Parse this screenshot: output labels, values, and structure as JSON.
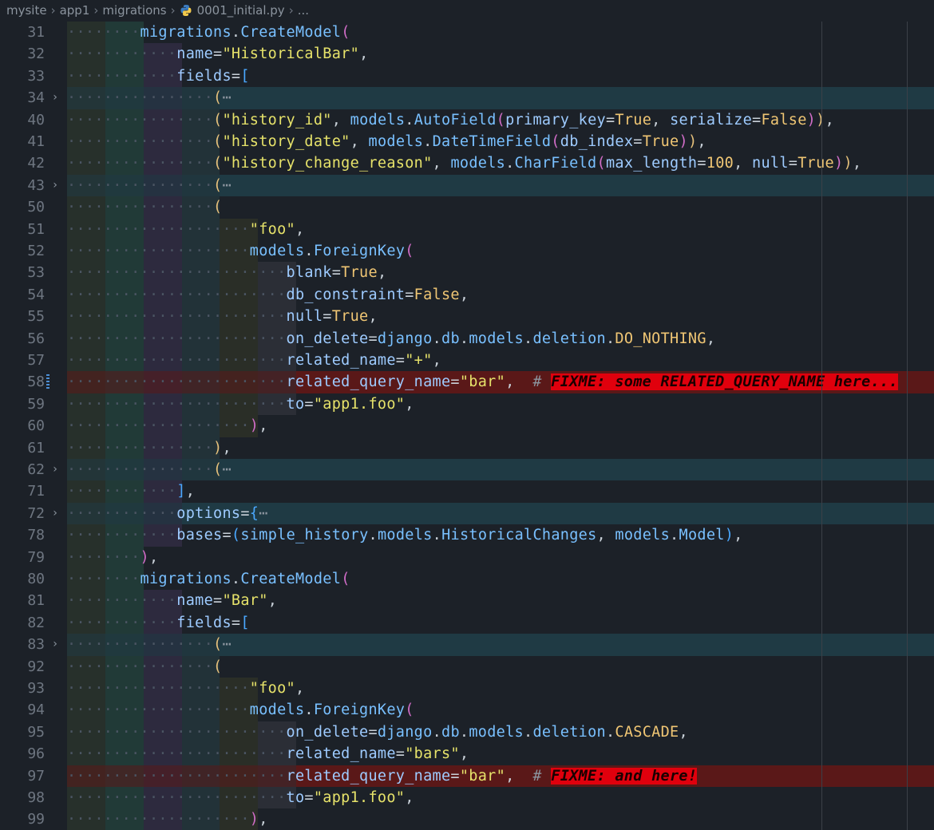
{
  "breadcrumb": {
    "items": [
      "mysite",
      "app1",
      "migrations",
      "0001_initial.py",
      "..."
    ]
  },
  "editor": {
    "lines": [
      {
        "n": "31",
        "indent": 2,
        "tokens": [
          [
            "f",
            "migrations"
          ],
          [
            "p",
            "."
          ],
          [
            "f",
            "CreateModel"
          ],
          [
            "b2",
            "("
          ]
        ]
      },
      {
        "n": "32",
        "indent": 3,
        "tokens": [
          [
            "k",
            "name"
          ],
          [
            "p",
            "="
          ],
          [
            "s",
            "\"HistoricalBar\""
          ],
          [
            "p",
            ","
          ]
        ]
      },
      {
        "n": "33",
        "indent": 3,
        "tokens": [
          [
            "k",
            "fields"
          ],
          [
            "p",
            "="
          ],
          [
            "b3",
            "["
          ]
        ]
      },
      {
        "n": "34",
        "indent": 4,
        "fold": true,
        "tokens": [
          [
            "b1",
            "("
          ],
          [
            "ell",
            "⋯"
          ]
        ]
      },
      {
        "n": "40",
        "indent": 4,
        "tokens": [
          [
            "b1",
            "("
          ],
          [
            "s",
            "\"history_id\""
          ],
          [
            "p",
            ", "
          ],
          [
            "f",
            "models"
          ],
          [
            "p",
            "."
          ],
          [
            "f",
            "AutoField"
          ],
          [
            "b2",
            "("
          ],
          [
            "k",
            "primary_key"
          ],
          [
            "p",
            "="
          ],
          [
            "n",
            "True"
          ],
          [
            "p",
            ", "
          ],
          [
            "k",
            "serialize"
          ],
          [
            "p",
            "="
          ],
          [
            "n",
            "False"
          ],
          [
            "b2",
            ")"
          ],
          [
            "b1",
            ")"
          ],
          [
            "p",
            ","
          ]
        ]
      },
      {
        "n": "41",
        "indent": 4,
        "tokens": [
          [
            "b1",
            "("
          ],
          [
            "s",
            "\"history_date\""
          ],
          [
            "p",
            ", "
          ],
          [
            "f",
            "models"
          ],
          [
            "p",
            "."
          ],
          [
            "f",
            "DateTimeField"
          ],
          [
            "b2",
            "("
          ],
          [
            "k",
            "db_index"
          ],
          [
            "p",
            "="
          ],
          [
            "n",
            "True"
          ],
          [
            "b2",
            ")"
          ],
          [
            "b1",
            ")"
          ],
          [
            "p",
            ","
          ]
        ]
      },
      {
        "n": "42",
        "indent": 4,
        "tokens": [
          [
            "b1",
            "("
          ],
          [
            "s",
            "\"history_change_reason\""
          ],
          [
            "p",
            ", "
          ],
          [
            "f",
            "models"
          ],
          [
            "p",
            "."
          ],
          [
            "f",
            "CharField"
          ],
          [
            "b2",
            "("
          ],
          [
            "k",
            "max_length"
          ],
          [
            "p",
            "="
          ],
          [
            "n",
            "100"
          ],
          [
            "p",
            ", "
          ],
          [
            "k",
            "null"
          ],
          [
            "p",
            "="
          ],
          [
            "n",
            "True"
          ],
          [
            "b2",
            ")"
          ],
          [
            "b1",
            ")"
          ],
          [
            "p",
            ","
          ]
        ]
      },
      {
        "n": "43",
        "indent": 4,
        "fold": true,
        "tokens": [
          [
            "b1",
            "("
          ],
          [
            "ell",
            "⋯"
          ]
        ]
      },
      {
        "n": "50",
        "indent": 4,
        "tokens": [
          [
            "b1",
            "("
          ]
        ]
      },
      {
        "n": "51",
        "indent": 5,
        "tokens": [
          [
            "s",
            "\"foo\""
          ],
          [
            "p",
            ","
          ]
        ]
      },
      {
        "n": "52",
        "indent": 5,
        "tokens": [
          [
            "f",
            "models"
          ],
          [
            "p",
            "."
          ],
          [
            "f",
            "ForeignKey"
          ],
          [
            "b2",
            "("
          ]
        ]
      },
      {
        "n": "53",
        "indent": 6,
        "tokens": [
          [
            "k",
            "blank"
          ],
          [
            "p",
            "="
          ],
          [
            "n",
            "True"
          ],
          [
            "p",
            ","
          ]
        ]
      },
      {
        "n": "54",
        "indent": 6,
        "tokens": [
          [
            "k",
            "db_constraint"
          ],
          [
            "p",
            "="
          ],
          [
            "n",
            "False"
          ],
          [
            "p",
            ","
          ]
        ]
      },
      {
        "n": "55",
        "indent": 6,
        "tokens": [
          [
            "k",
            "null"
          ],
          [
            "p",
            "="
          ],
          [
            "n",
            "True"
          ],
          [
            "p",
            ","
          ]
        ]
      },
      {
        "n": "56",
        "indent": 6,
        "tokens": [
          [
            "k",
            "on_delete"
          ],
          [
            "p",
            "="
          ],
          [
            "f",
            "django"
          ],
          [
            "p",
            "."
          ],
          [
            "f",
            "db"
          ],
          [
            "p",
            "."
          ],
          [
            "f",
            "models"
          ],
          [
            "p",
            "."
          ],
          [
            "f",
            "deletion"
          ],
          [
            "p",
            "."
          ],
          [
            "n",
            "DO_NOTHING"
          ],
          [
            "p",
            ","
          ]
        ]
      },
      {
        "n": "57",
        "indent": 6,
        "tokens": [
          [
            "k",
            "related_name"
          ],
          [
            "p",
            "="
          ],
          [
            "s",
            "\"+\""
          ],
          [
            "p",
            ","
          ]
        ]
      },
      {
        "n": "58",
        "indent": 6,
        "err": true,
        "mod": true,
        "tokens": [
          [
            "k",
            "related_query_name"
          ],
          [
            "p",
            "="
          ],
          [
            "s",
            "\"bar\""
          ],
          [
            "p",
            ",  "
          ],
          [
            "cm",
            "# "
          ],
          [
            "fix",
            "FIXME: some RELATED_QUERY_NAME here..."
          ]
        ]
      },
      {
        "n": "59",
        "indent": 6,
        "tokens": [
          [
            "k",
            "to"
          ],
          [
            "p",
            "="
          ],
          [
            "s",
            "\"app1.foo\""
          ],
          [
            "p",
            ","
          ]
        ]
      },
      {
        "n": "60",
        "indent": 5,
        "tokens": [
          [
            "b2",
            ")"
          ],
          [
            "p",
            ","
          ]
        ]
      },
      {
        "n": "61",
        "indent": 4,
        "tokens": [
          [
            "b1",
            ")"
          ],
          [
            "p",
            ","
          ]
        ]
      },
      {
        "n": "62",
        "indent": 4,
        "fold": true,
        "tokens": [
          [
            "b1",
            "("
          ],
          [
            "ell",
            "⋯"
          ]
        ]
      },
      {
        "n": "71",
        "indent": 3,
        "tokens": [
          [
            "b3",
            "]"
          ],
          [
            "p",
            ","
          ]
        ]
      },
      {
        "n": "72",
        "indent": 3,
        "fold": true,
        "tokens": [
          [
            "k",
            "options"
          ],
          [
            "p",
            "="
          ],
          [
            "b3",
            "{"
          ],
          [
            "ell",
            "⋯"
          ]
        ]
      },
      {
        "n": "78",
        "indent": 3,
        "tokens": [
          [
            "k",
            "bases"
          ],
          [
            "p",
            "="
          ],
          [
            "b3",
            "("
          ],
          [
            "f",
            "simple_history"
          ],
          [
            "p",
            "."
          ],
          [
            "f",
            "models"
          ],
          [
            "p",
            "."
          ],
          [
            "f",
            "HistoricalChanges"
          ],
          [
            "p",
            ", "
          ],
          [
            "f",
            "models"
          ],
          [
            "p",
            "."
          ],
          [
            "f",
            "Model"
          ],
          [
            "b3",
            ")"
          ],
          [
            "p",
            ","
          ]
        ]
      },
      {
        "n": "79",
        "indent": 2,
        "tokens": [
          [
            "b2",
            ")"
          ],
          [
            "p",
            ","
          ]
        ]
      },
      {
        "n": "80",
        "indent": 2,
        "tokens": [
          [
            "f",
            "migrations"
          ],
          [
            "p",
            "."
          ],
          [
            "f",
            "CreateModel"
          ],
          [
            "b2",
            "("
          ]
        ]
      },
      {
        "n": "81",
        "indent": 3,
        "tokens": [
          [
            "k",
            "name"
          ],
          [
            "p",
            "="
          ],
          [
            "s",
            "\"Bar\""
          ],
          [
            "p",
            ","
          ]
        ]
      },
      {
        "n": "82",
        "indent": 3,
        "tokens": [
          [
            "k",
            "fields"
          ],
          [
            "p",
            "="
          ],
          [
            "b3",
            "["
          ]
        ]
      },
      {
        "n": "83",
        "indent": 4,
        "fold": true,
        "tokens": [
          [
            "b1",
            "("
          ],
          [
            "ell",
            "⋯"
          ]
        ]
      },
      {
        "n": "92",
        "indent": 4,
        "tokens": [
          [
            "b1",
            "("
          ]
        ]
      },
      {
        "n": "93",
        "indent": 5,
        "tokens": [
          [
            "s",
            "\"foo\""
          ],
          [
            "p",
            ","
          ]
        ]
      },
      {
        "n": "94",
        "indent": 5,
        "tokens": [
          [
            "f",
            "models"
          ],
          [
            "p",
            "."
          ],
          [
            "f",
            "ForeignKey"
          ],
          [
            "b2",
            "("
          ]
        ]
      },
      {
        "n": "95",
        "indent": 6,
        "tokens": [
          [
            "k",
            "on_delete"
          ],
          [
            "p",
            "="
          ],
          [
            "f",
            "django"
          ],
          [
            "p",
            "."
          ],
          [
            "f",
            "db"
          ],
          [
            "p",
            "."
          ],
          [
            "f",
            "models"
          ],
          [
            "p",
            "."
          ],
          [
            "f",
            "deletion"
          ],
          [
            "p",
            "."
          ],
          [
            "n",
            "CASCADE"
          ],
          [
            "p",
            ","
          ]
        ]
      },
      {
        "n": "96",
        "indent": 6,
        "tokens": [
          [
            "k",
            "related_name"
          ],
          [
            "p",
            "="
          ],
          [
            "s",
            "\"bars\""
          ],
          [
            "p",
            ","
          ]
        ]
      },
      {
        "n": "97",
        "indent": 6,
        "err": true,
        "tokens": [
          [
            "k",
            "related_query_name"
          ],
          [
            "p",
            "="
          ],
          [
            "s",
            "\"bar\""
          ],
          [
            "p",
            ",  "
          ],
          [
            "cm",
            "# "
          ],
          [
            "fix",
            "FIXME: and here!"
          ]
        ]
      },
      {
        "n": "98",
        "indent": 6,
        "tokens": [
          [
            "k",
            "to"
          ],
          [
            "p",
            "="
          ],
          [
            "s",
            "\"app1.foo\""
          ],
          [
            "p",
            ","
          ]
        ]
      },
      {
        "n": "99",
        "indent": 5,
        "tokens": [
          [
            "b2",
            ")"
          ],
          [
            "p",
            ","
          ]
        ]
      }
    ]
  }
}
